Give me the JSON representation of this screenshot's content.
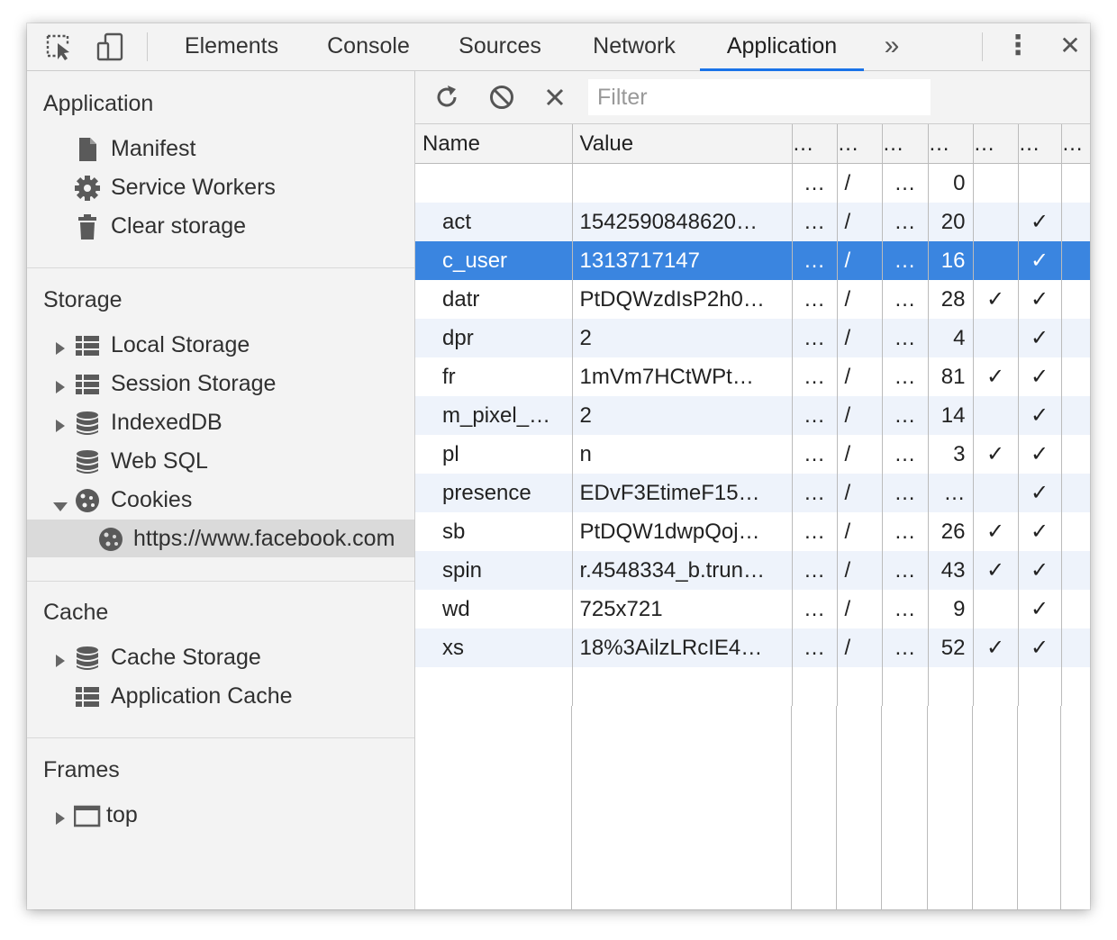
{
  "toolbar": {
    "tabs": [
      "Elements",
      "Console",
      "Sources",
      "Network",
      "Application"
    ],
    "active_tab": "Application",
    "more_tabs_glyph": "»",
    "kebab_glyph": "⋮",
    "close_glyph": "✕"
  },
  "sidebar": {
    "application": {
      "title": "Application",
      "items": [
        "Manifest",
        "Service Workers",
        "Clear storage"
      ]
    },
    "storage": {
      "title": "Storage",
      "items": [
        "Local Storage",
        "Session Storage",
        "IndexedDB",
        "Web SQL",
        "Cookies"
      ],
      "cookie_origin": "https://www.facebook.com"
    },
    "cache": {
      "title": "Cache",
      "items": [
        "Cache Storage",
        "Application Cache"
      ]
    },
    "frames": {
      "title": "Frames",
      "items": [
        "top"
      ]
    }
  },
  "cookies": {
    "filter_placeholder": "Filter",
    "columns": [
      "Name",
      "Value",
      "…",
      "…",
      "…",
      "…",
      "…",
      "…",
      "…"
    ],
    "rows": [
      {
        "name": "",
        "value": "",
        "domain": "…",
        "path": "/",
        "expires": "…",
        "size": "0",
        "http_only": "",
        "secure": ""
      },
      {
        "name": "act",
        "value": "1542590848620…",
        "domain": "…",
        "path": "/",
        "expires": "…",
        "size": "20",
        "http_only": "",
        "secure": "✓"
      },
      {
        "name": "c_user",
        "value": "1313717147",
        "domain": "…",
        "path": "/",
        "expires": "…",
        "size": "16",
        "http_only": "",
        "secure": "✓"
      },
      {
        "name": "datr",
        "value": "PtDQWzdIsP2h0…",
        "domain": "…",
        "path": "/",
        "expires": "…",
        "size": "28",
        "http_only": "✓",
        "secure": "✓"
      },
      {
        "name": "dpr",
        "value": "2",
        "domain": "…",
        "path": "/",
        "expires": "…",
        "size": "4",
        "http_only": "",
        "secure": "✓"
      },
      {
        "name": "fr",
        "value": "1mVm7HCtWPt…",
        "domain": "…",
        "path": "/",
        "expires": "…",
        "size": "81",
        "http_only": "✓",
        "secure": "✓"
      },
      {
        "name": "m_pixel_…",
        "value": "2",
        "domain": "…",
        "path": "/",
        "expires": "…",
        "size": "14",
        "http_only": "",
        "secure": "✓"
      },
      {
        "name": "pl",
        "value": "n",
        "domain": "…",
        "path": "/",
        "expires": "…",
        "size": "3",
        "http_only": "✓",
        "secure": "✓"
      },
      {
        "name": "presence",
        "value": "EDvF3EtimeF15…",
        "domain": "…",
        "path": "/",
        "expires": "…",
        "size": "…",
        "http_only": "",
        "secure": "✓"
      },
      {
        "name": "sb",
        "value": "PtDQW1dwpQoj…",
        "domain": "…",
        "path": "/",
        "expires": "…",
        "size": "26",
        "http_only": "✓",
        "secure": "✓"
      },
      {
        "name": "spin",
        "value": "r.4548334_b.trun…",
        "domain": "…",
        "path": "/",
        "expires": "…",
        "size": "43",
        "http_only": "✓",
        "secure": "✓"
      },
      {
        "name": "wd",
        "value": "725x721",
        "domain": "…",
        "path": "/",
        "expires": "…",
        "size": "9",
        "http_only": "",
        "secure": "✓"
      },
      {
        "name": "xs",
        "value": "18%3AilzLRcIE4…",
        "domain": "…",
        "path": "/",
        "expires": "…",
        "size": "52",
        "http_only": "✓",
        "secure": "✓"
      }
    ],
    "selected_row": "c_user"
  },
  "colors": {
    "accent": "#1a73e8",
    "selection": "#3a85e0",
    "panel_bg": "#f3f3f3",
    "stripe": "#eef3fb"
  }
}
